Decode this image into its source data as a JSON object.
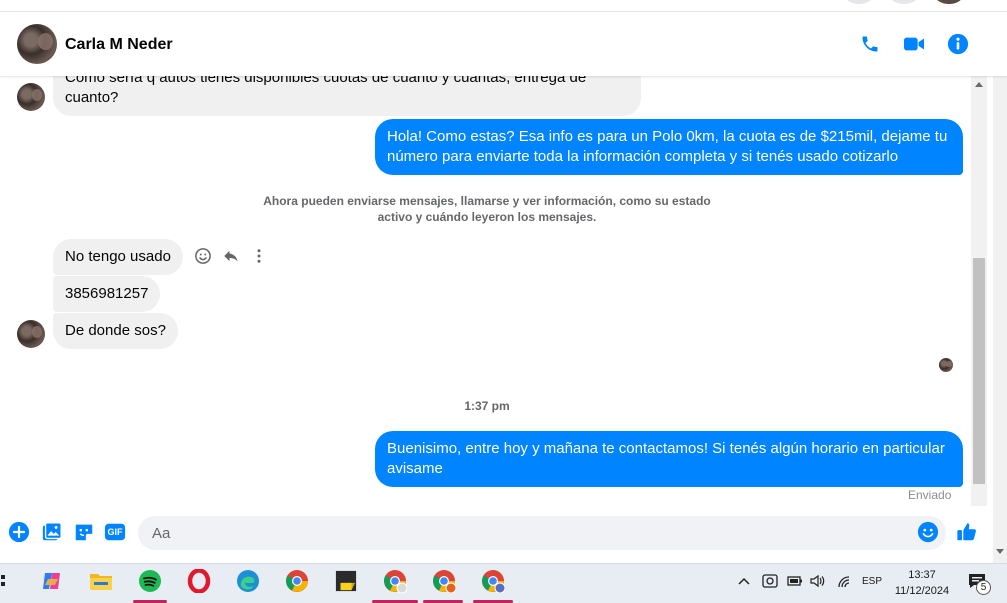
{
  "header": {
    "contact_name": "Carla M Neder"
  },
  "messages": {
    "incoming_top": "Como sería q autos tienes disponibles cuotas de cuanto y cuantas, entrega de cuanto?",
    "outgoing_1": "Hola! Como estas? Esa info es para un Polo 0km, la cuota es de $215mil, dejame tu número para enviarte toda la información completa y si tenés usado cotizarlo",
    "system_notice": "Ahora pueden enviarse mensajes, llamarse y ver información, como su estado activo y cuándo leyeron los mensajes.",
    "incoming_2": "No tengo usado",
    "incoming_3": "3856981257",
    "incoming_4": "De donde sos?",
    "timestamp": "1:37 pm",
    "outgoing_2": "Buenisimo, entre hoy y mañana te contactamos! Si tenés algún horario en particular avisame",
    "status": "Enviado"
  },
  "composer": {
    "placeholder": "Aa",
    "gif_label": "GIF"
  },
  "taskbar": {
    "language": "ESP",
    "time": "13:37",
    "date": "11/12/2024",
    "notification_count": "5"
  },
  "colors": {
    "accent": "#0084ff",
    "incoming_bubble": "#f0f0f0",
    "taskbar_indicator": "#c0245f"
  }
}
